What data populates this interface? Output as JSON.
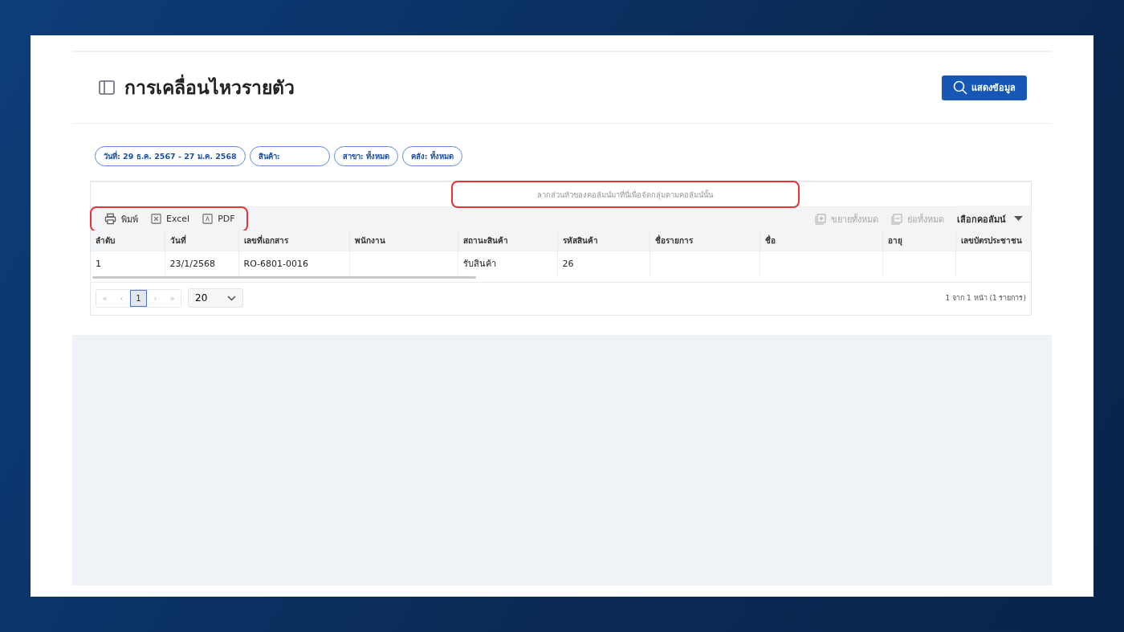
{
  "page": {
    "title": "การเคลื่อนไหวรายตัว",
    "show_button": "แสดงข้อมูล"
  },
  "filters": [
    "วันที่: 29 ธ.ค. 2567 - 27 ม.ค. 2568",
    "สินค้า:",
    "สาขา: ทั้งหมด",
    "คลัง: ทั้งหมด"
  ],
  "grid": {
    "group_hint": "ลากส่วนหัวของคอลัมน์มาที่นี่เพื่อจัดกลุ่มตามคอลัมน์นั้น",
    "export_buttons": [
      {
        "kind": "print",
        "label": "พิมพ์"
      },
      {
        "kind": "excel",
        "label": "Excel"
      },
      {
        "kind": "pdf",
        "label": "PDF"
      }
    ],
    "expand_all": {
      "label": "ขยายทั้งหมด",
      "disabled": true
    },
    "collapse_all": {
      "label": "ย่อทั้งหมด",
      "disabled": true
    },
    "column_chooser": "เลือกคอลัมน์",
    "columns": [
      "ลำดับ",
      "วันที่",
      "เลขที่เอกสาร",
      "พนักงาน",
      "สถานะสินค้า",
      "รหัสสินค้า",
      "ชื่อรายการ",
      "ชื่อ",
      "อายุ",
      "เลขบัตรประชาชน"
    ],
    "rows": [
      [
        "1",
        "23/1/2568",
        "RO-6801-0016",
        "",
        "รับสินค้า",
        "26",
        "",
        "",
        "",
        ""
      ]
    ],
    "pager": {
      "first": "«",
      "prev": "‹",
      "next": "›",
      "last": "»",
      "pages": [
        {
          "label": "1",
          "selected": true
        }
      ],
      "page_size": "20",
      "summary": "1 จาก 1 หน้า (1 รายการ)"
    }
  }
}
